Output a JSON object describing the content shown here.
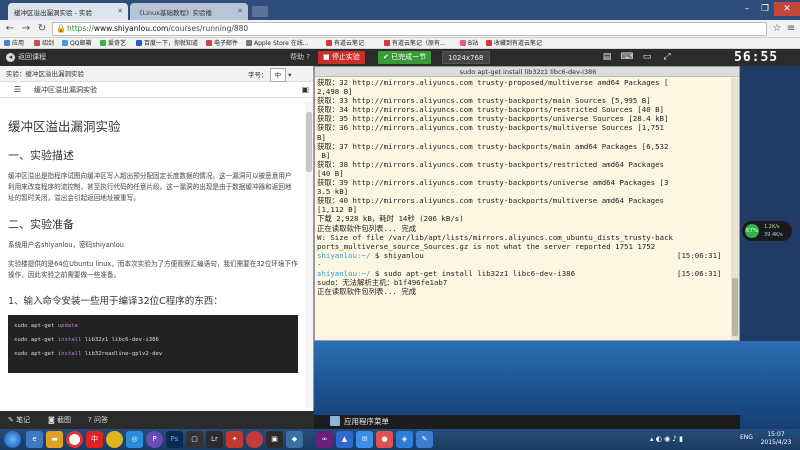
{
  "browser": {
    "tabs": [
      {
        "label": "缓冲区溢出漏洞实验 - 实验"
      },
      {
        "label": "《Linux基础教程》实验楼"
      }
    ],
    "url_scheme": "https://",
    "url_host": "www.shiyanlou.com",
    "url_path": "/courses/running/880",
    "bookmarks": [
      {
        "label": "应用",
        "color": "#4a7fd1"
      },
      {
        "label": "绍剑",
        "color": "#d14a4a"
      },
      {
        "label": "QQ邮箱",
        "color": "#3ca0e0"
      },
      {
        "label": "爱奇艺",
        "color": "#3cb43c"
      },
      {
        "label": "百度一下，你就知道",
        "color": "#2a5bd4"
      },
      {
        "label": "电子邮件",
        "color": "#c44"
      },
      {
        "label": "Apple Store 在线...",
        "color": "#777"
      },
      {
        "label": "有道云笔记",
        "color": "#d33"
      },
      {
        "label": "有道云笔记（原有...",
        "color": "#d33"
      },
      {
        "label": "B站",
        "color": "#e45c8c"
      },
      {
        "label": "收藏到有道云笔记",
        "color": "#d33"
      }
    ]
  },
  "toolbar": {
    "back_label": "返回课程",
    "help_label": "帮助 ?",
    "stop_label": "停止实验",
    "done_label": "已完成一节",
    "resolution": "1024x768",
    "clock": "56:55"
  },
  "lesson": {
    "header": "实验：缓冲区溢出漏洞实验",
    "font_label": "字号：",
    "font_value": "中",
    "toc_title": "缓冲区溢出漏洞实验",
    "title": "缓冲区溢出漏洞实验",
    "s1": "一、实验描述",
    "p1": "缓冲区溢出是指程序试图向缓冲区写入超出预分配固定长度数据的情况。这一漏洞可以被恶意用户利用来改变程序的流控制，甚至执行代码的任意片段。这一漏洞的出现是由于数据缓冲器和返回地址的暂时关闭，溢出会引起返回地址被重写。",
    "s2": "二、实验准备",
    "p2": "系统用户名shiyanlou，密码shiyanlou",
    "p3": "实验楼提供的是64位Ubuntu linux，而本次实验为了方便观察汇编语句，我们需要在32位环境下作操作，因此实验之前需要做一些准备。",
    "s3": "1、输入命令安装一些用于编译32位C程序的东西：",
    "code": [
      {
        "cmd": "sudo apt-get ",
        "kw": "update",
        "rest": ""
      },
      {
        "cmd": "sudo apt-get ",
        "kw": "install",
        "rest": " lib32z1 libc6-dev-i386"
      },
      {
        "cmd": "sudo apt-get ",
        "kw": "install",
        "rest": " lib32readline-gplv2-dev"
      }
    ],
    "bottom": [
      "笔记",
      "截图",
      "问答"
    ]
  },
  "terminal": {
    "title": "sudo apt-get install lib32z1 libc6-dev-i386",
    "lines": [
      "获取：32 http://mirrors.aliyuncs.com trusty-proposed/multiverse amd64 Packages [",
      "2,498 B]",
      "获取：33 http://mirrors.aliyuncs.com trusty-backports/main Sources [5,995 B]",
      "获取：34 http://mirrors.aliyuncs.com trusty-backports/restricted Sources [40 B]",
      "获取：35 http://mirrors.aliyuncs.com trusty-backports/universe Sources [28.4 kB]",
      "获取：36 http://mirrors.aliyuncs.com trusty-backports/multiverse Sources [1,751",
      "B]",
      "获取：37 http://mirrors.aliyuncs.com trusty-backports/main amd64 Packages [6,532",
      " B]",
      "获取：38 http://mirrors.aliyuncs.com trusty-backports/restricted amd64 Packages",
      "[40 B]",
      "获取：39 http://mirrors.aliyuncs.com trusty-backports/universe amd64 Packages [3",
      "3.5 kB]",
      "获取：40 http://mirrors.aliyuncs.com trusty-backports/multiverse amd64 Packages",
      "[1,112 B]",
      "下载 2,928 kB，耗时 14秒 (206 kB/s)",
      "正在读取软件包列表... 完成",
      "W: Size of file /var/lib/apt/lists/mirrors.aliyuncs.com_ubuntu_dists_trusty-back",
      "ports_multiverse_source_Sources.gz is not what the server reported 1751 1752"
    ],
    "prompt_user": "shiyanlou",
    "prompt_path": ":~/",
    "cmd1": " $ shiyanlou",
    "time1": "[15:06:31]",
    "tilde": "-",
    "cmd2": " $ sudo apt-get install lib32z1 libc6-dev-i386",
    "time2": "[15:06:31]",
    "out1": "sudo：无法解析主机：b1f496fe1ab7",
    "out2": "正在读取软件包列表... 完成"
  },
  "desktop": {
    "app_menu": "应用程序菜单",
    "net_percent": "57%",
    "net_up": "1.2K/s",
    "net_down": "39.4K/s"
  },
  "taskbar": {
    "lang": "ENG",
    "time": "15:07",
    "date": "2015/4/23"
  }
}
